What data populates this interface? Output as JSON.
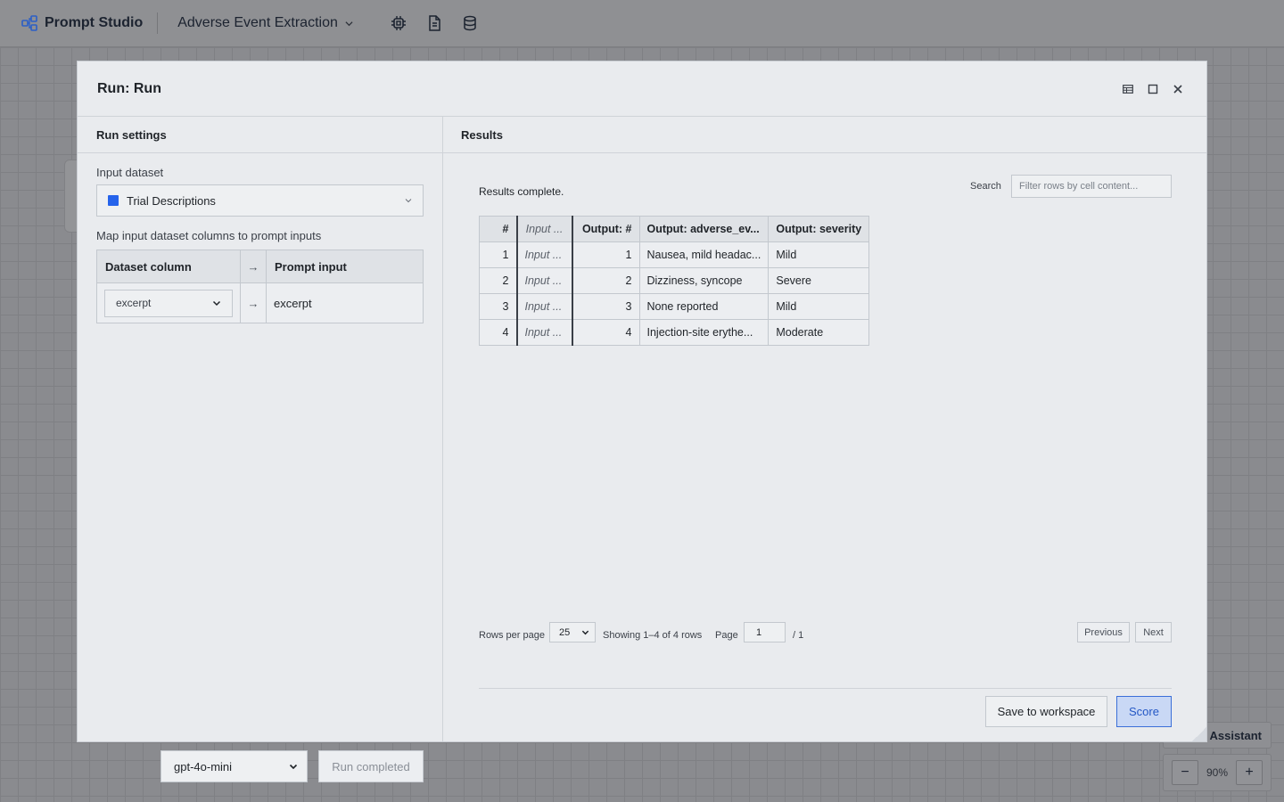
{
  "app": {
    "brand": "Prompt Studio",
    "project": "Adverse Event Extraction",
    "toolbar_icons": [
      "chip-icon",
      "document-icon",
      "database-icon"
    ]
  },
  "canvas": {
    "assistant_label": "nt Assistant",
    "zoom_out": "−",
    "zoom_level": "90%",
    "zoom_in": "+"
  },
  "modal": {
    "title": "Run: Run",
    "actions": [
      "table-icon",
      "maximize-icon",
      "close-icon"
    ],
    "settings": {
      "header": "Run settings",
      "input_dataset_label": "Input dataset",
      "dataset_value": "Trial Descriptions",
      "dataset_color": "#2563eb",
      "map_label": "Map input dataset columns to prompt inputs",
      "map_headers": {
        "dataset_column": "Dataset column",
        "arrow": "→",
        "prompt_input": "Prompt input"
      },
      "map_rows": [
        {
          "dataset_column": "excerpt",
          "arrow": "→",
          "prompt_input": "excerpt"
        }
      ],
      "model": "gpt-4o-mini",
      "run_button": "Run completed"
    },
    "results": {
      "header": "Results",
      "status": "Results complete.",
      "search_label": "Search",
      "search_placeholder": "Filter rows by cell content...",
      "columns": [
        "#",
        "Input ...",
        "Output: #",
        "Output: adverse_ev...",
        "Output: severity"
      ],
      "rows": [
        {
          "n": "1",
          "input": "Input ...",
          "onum": "1",
          "ae": "Nausea, mild headac...",
          "sev": "Mild"
        },
        {
          "n": "2",
          "input": "Input ...",
          "onum": "2",
          "ae": "Dizziness, syncope",
          "sev": "Severe"
        },
        {
          "n": "3",
          "input": "Input ...",
          "onum": "3",
          "ae": "None reported",
          "sev": "Mild"
        },
        {
          "n": "4",
          "input": "Input ...",
          "onum": "4",
          "ae": "Injection-site erythe...",
          "sev": "Moderate"
        }
      ],
      "pager": {
        "rows_per_page_label": "Rows per page",
        "rows_per_page": "25",
        "showing": "Showing 1–4 of 4 rows",
        "page_label": "Page",
        "page": "1",
        "total": "/ 1",
        "previous": "Previous",
        "next": "Next"
      },
      "save_button": "Save to workspace",
      "score_button": "Score"
    }
  }
}
